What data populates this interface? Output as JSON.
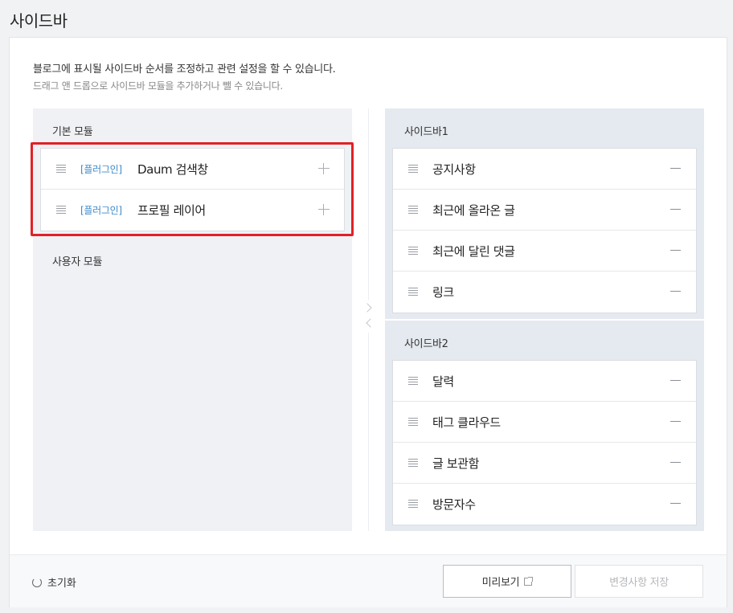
{
  "page": {
    "title": "사이드바"
  },
  "description": {
    "line1": "블로그에 표시될 사이드바 순서를 조정하고 관련 설정을 할 수 있습니다.",
    "line2": "드래그 앤 드롭으로 사이드바 모듈을 추가하거나 뺄 수 있습니다."
  },
  "basic_modules": {
    "title": "기본 모듈",
    "items": [
      {
        "tag": "[플러그인]",
        "label": "Daum 검색창"
      },
      {
        "tag": "[플러그인]",
        "label": "프로필 레이어"
      }
    ]
  },
  "user_modules": {
    "title": "사용자 모듈"
  },
  "sidebar1": {
    "title": "사이드바1",
    "items": [
      {
        "label": "공지사항"
      },
      {
        "label": "최근에 올라온 글"
      },
      {
        "label": "최근에 달린 댓글"
      },
      {
        "label": "링크"
      }
    ]
  },
  "sidebar2": {
    "title": "사이드바2",
    "items": [
      {
        "label": "달력"
      },
      {
        "label": "태그 클라우드"
      },
      {
        "label": "글 보관함"
      },
      {
        "label": "방문자수"
      }
    ]
  },
  "footer": {
    "reset_label": "초기화",
    "preview_label": "미리보기",
    "save_label": "변경사항 저장"
  },
  "colors": {
    "plugin_tag": "#3d8ac9",
    "highlight_border": "#e02127",
    "sidebar_bg": "#e5eaf0",
    "module_bg": "#f0f1f4"
  }
}
